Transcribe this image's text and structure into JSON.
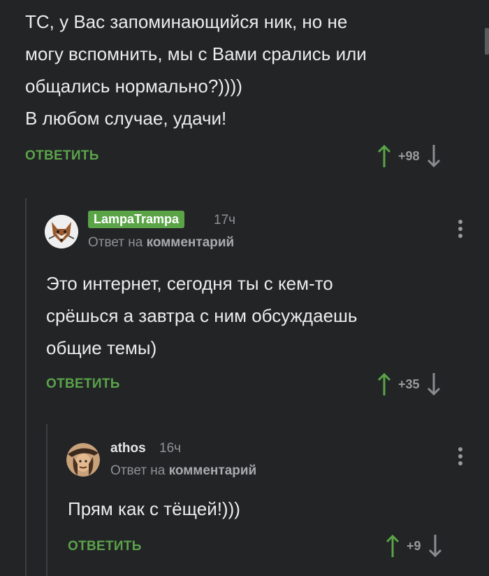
{
  "comments": [
    {
      "lines": [
        "ТС, у Вас запоминающийся ник, но не",
        "могу вспомнить, мы с Вами срались или",
        "общались нормально?))))",
        "В любом случае, удачи!"
      ],
      "reply_label": "ОТВЕТИТЬ",
      "score": "+98"
    },
    {
      "username": "LampaTrampa",
      "time": "17ч",
      "meta_prefix": "Ответ на",
      "meta_link": "комментарий",
      "lines": [
        "Это интернет, сегодня ты с кем-то",
        "срёшься а завтра с ним обсуждаешь",
        "общие темы)"
      ],
      "reply_label": "ОТВЕТИТЬ",
      "score": "+35"
    },
    {
      "username": "athos",
      "time": "16ч",
      "meta_prefix": "Ответ на",
      "meta_link": "комментарий",
      "lines": [
        "Прям как с тёщей!)))"
      ],
      "reply_label": "ОТВЕТИТЬ",
      "score": "+9"
    }
  ],
  "colors": {
    "accent": "#5aa447",
    "background": "#222426"
  },
  "icons": [
    "upvote-arrow-icon",
    "downvote-arrow-icon",
    "more-options-icon",
    "fox-avatar",
    "musketeer-avatar"
  ]
}
